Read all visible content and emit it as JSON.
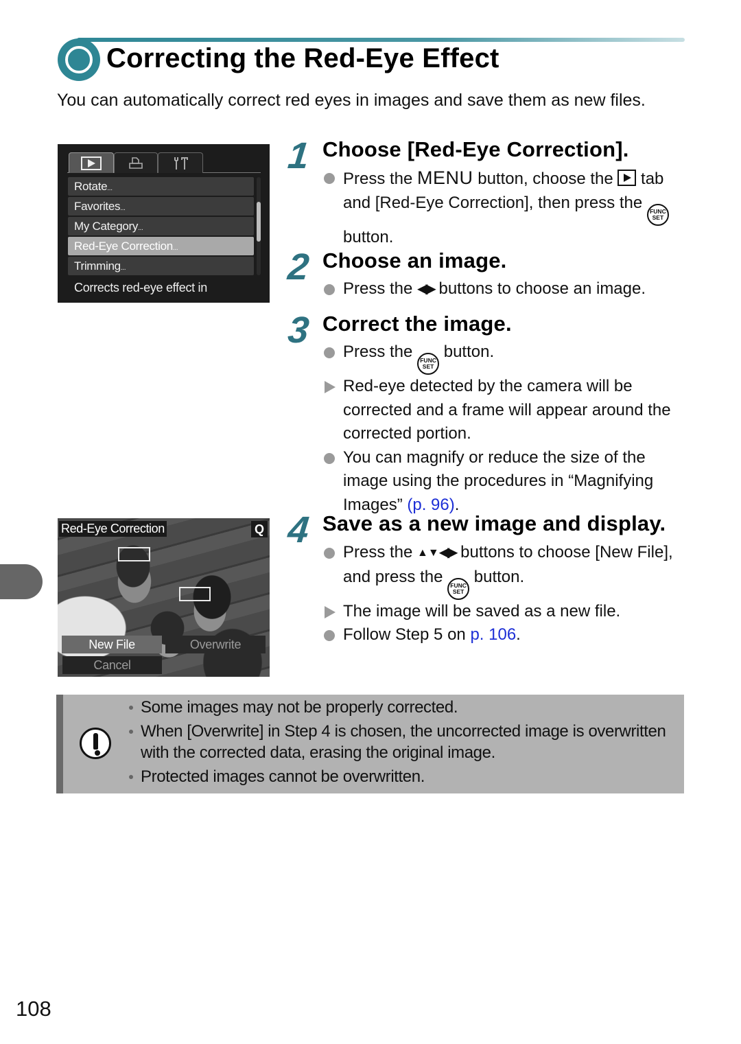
{
  "page": {
    "title": "Correcting the Red-Eye Effect",
    "intro": "You can automatically correct red eyes in images and save them as new files.",
    "page_number": "108",
    "accent_color": "#2e8694"
  },
  "camera_menu": {
    "tabs": [
      {
        "icon": "playback-tab-icon",
        "active": true
      },
      {
        "icon": "print-tab-icon",
        "active": false
      },
      {
        "icon": "settings-tools-tab-icon",
        "active": false
      }
    ],
    "items": [
      {
        "label": "Rotate",
        "suffix": "...",
        "selected": false
      },
      {
        "label": "Favorites",
        "suffix": "...",
        "selected": false
      },
      {
        "label": "My Category",
        "suffix": "...",
        "selected": false
      },
      {
        "label": "Red-Eye Correction",
        "suffix": "...",
        "selected": true
      },
      {
        "label": "Trimming",
        "suffix": "...",
        "selected": false
      }
    ],
    "hint": "Corrects red-eye effect in"
  },
  "steps": [
    {
      "number": "1",
      "title": "Choose [Red-Eye Correction].",
      "bullets": [
        {
          "type": "action",
          "parts": {
            "a": "Press the ",
            "menu": "MENU",
            "b": " button, choose the ",
            "c": " tab and [Red-Eye Correction], then press the ",
            "d": " button."
          }
        }
      ]
    },
    {
      "number": "2",
      "title": "Choose an image.",
      "bullets": [
        {
          "type": "action",
          "parts": {
            "a": "Press the ",
            "b": " buttons to choose an image."
          }
        }
      ]
    },
    {
      "number": "3",
      "title": "Correct the image.",
      "bullets": [
        {
          "type": "action",
          "parts": {
            "a": "Press the ",
            "b": " button."
          }
        },
        {
          "type": "result",
          "text": "Red-eye detected by the camera will be corrected and a frame will appear around the corrected portion."
        },
        {
          "type": "action",
          "parts": {
            "a": "You can magnify or reduce the size of the image using the procedures in “Magnifying Images” ",
            "link": "(p. 96)",
            "b": "."
          }
        }
      ]
    },
    {
      "number": "4",
      "title": "Save as a new image and display.",
      "bullets": [
        {
          "type": "action",
          "parts": {
            "a": "Press the ",
            "b": " buttons to choose [New File], and press the ",
            "c": " button."
          }
        },
        {
          "type": "result",
          "text": "The image will be saved as a new file."
        },
        {
          "type": "action",
          "parts": {
            "a": "Follow Step 5 on ",
            "link": "p. 106",
            "b": "."
          }
        }
      ]
    }
  ],
  "camera_photo": {
    "title": "Red-Eye Correction",
    "zoom_icon": "Q",
    "buttons": {
      "new_file": "New File",
      "overwrite": "Overwrite",
      "cancel": "Cancel"
    }
  },
  "icons": {
    "func_top": "FUNC",
    "func_bottom": "SET",
    "arrows_lr": "◀▶",
    "arrows_ud": "▲▼"
  },
  "caution": {
    "items": [
      "Some images may not be properly corrected.",
      "When [Overwrite] in Step 4 is chosen, the uncorrected image is overwritten with the corrected data, erasing the original image.",
      "Protected images cannot be overwritten."
    ]
  }
}
